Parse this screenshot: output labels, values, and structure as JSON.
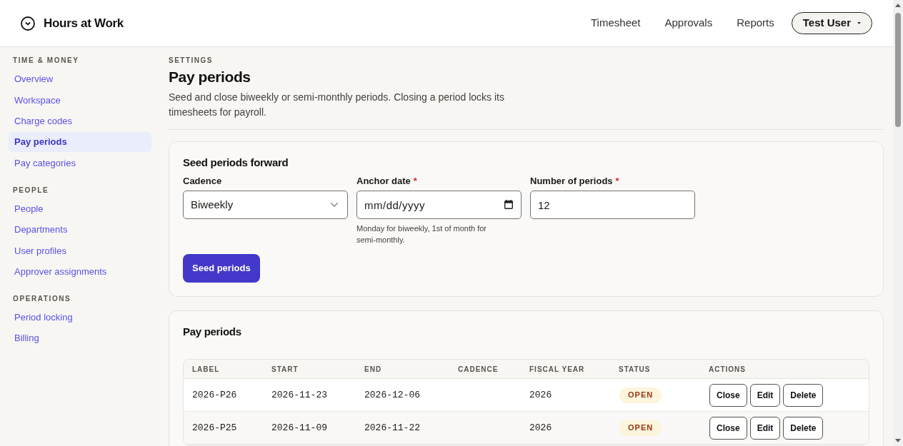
{
  "header": {
    "app_name": "Hours at Work",
    "nav": [
      {
        "label": "Timesheet"
      },
      {
        "label": "Approvals"
      },
      {
        "label": "Reports"
      }
    ],
    "user_menu": {
      "label": "Test User"
    }
  },
  "sidebar": {
    "sections": [
      {
        "heading": "TIME & MONEY",
        "items": [
          {
            "label": "Overview",
            "selected": false
          },
          {
            "label": "Workspace",
            "selected": false
          },
          {
            "label": "Charge codes",
            "selected": false
          },
          {
            "label": "Pay periods",
            "selected": true
          },
          {
            "label": "Pay categories",
            "selected": false
          }
        ]
      },
      {
        "heading": "PEOPLE",
        "items": [
          {
            "label": "People",
            "selected": false
          },
          {
            "label": "Departments",
            "selected": false
          },
          {
            "label": "User profiles",
            "selected": false
          },
          {
            "label": "Approver assignments",
            "selected": false
          }
        ]
      },
      {
        "heading": "OPERATIONS",
        "items": [
          {
            "label": "Period locking",
            "selected": false
          },
          {
            "label": "Billing",
            "selected": false
          }
        ]
      }
    ]
  },
  "page": {
    "eyebrow": "SETTINGS",
    "title": "Pay periods",
    "description": "Seed and close biweekly or semi-monthly periods. Closing a period locks its timesheets for payroll."
  },
  "seed_form": {
    "title": "Seed periods forward",
    "fields": [
      {
        "kind": "select",
        "label": "Cadence",
        "value": "Biweekly"
      },
      {
        "kind": "date",
        "label": "Anchor date",
        "required_mark": "*",
        "placeholder": "mm/dd/yyyy",
        "hint": "Monday for biweekly, 1st of month for semi-monthly."
      },
      {
        "kind": "number",
        "label": "Number of periods",
        "required_mark": "*",
        "value": "12"
      }
    ],
    "submit": "Seed periods"
  },
  "pay_periods": {
    "title": "Pay periods",
    "table": {
      "columns": [
        "LABEL",
        "START",
        "END",
        "CADENCE",
        "FISCAL YEAR",
        "STATUS",
        "ACTIONS"
      ],
      "rows": [
        {
          "label": "2026-P26",
          "start": "2026-11-23",
          "end": "2026-12-06",
          "fiscal_year": "2026",
          "status": "OPEN",
          "actions": [
            "Close",
            "Edit",
            "Delete"
          ]
        },
        {
          "label": "2026-P25",
          "start": "2026-11-09",
          "end": "2026-11-22",
          "fiscal_year": "2026",
          "status": "OPEN",
          "actions": [
            "Close",
            "Edit",
            "Delete"
          ]
        }
      ]
    }
  }
}
